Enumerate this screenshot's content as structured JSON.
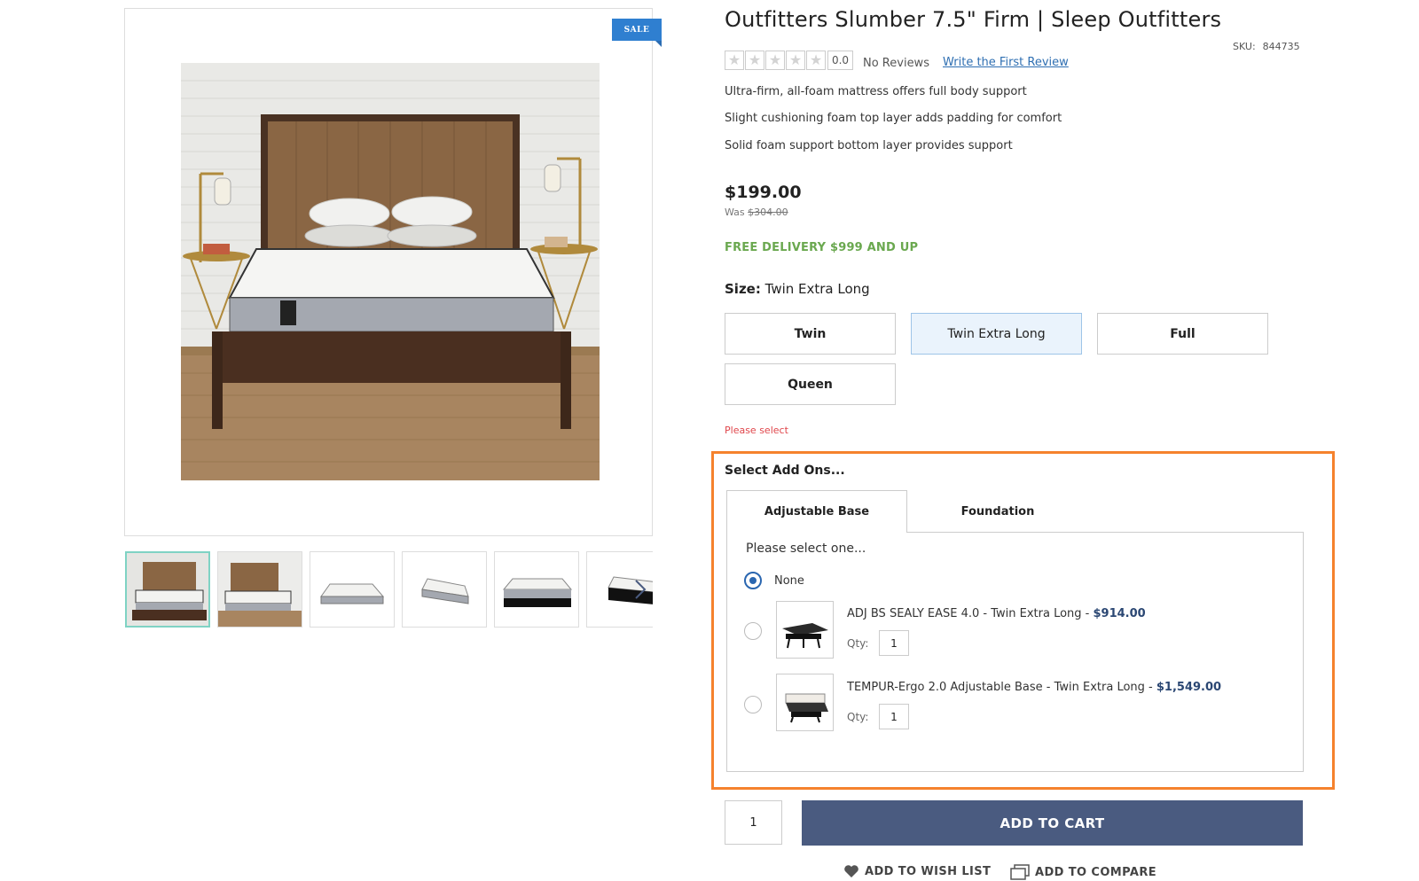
{
  "gallery": {
    "badge": "SALE",
    "thumbnails": [
      {
        "icon": "bedroom-photo"
      },
      {
        "icon": "bedroom-photo"
      },
      {
        "icon": "mattress-photo"
      },
      {
        "icon": "mattress-photo"
      },
      {
        "icon": "mattress-photo"
      },
      {
        "icon": "mattress-photo"
      }
    ],
    "next_icon": "chevron-right-icon"
  },
  "product": {
    "title": "Outfitters Slumber 7.5\" Firm | Sleep Outfitters",
    "sku_label": "SKU:",
    "sku_value": "844735",
    "rating_score": "0.0",
    "reviews_text": "No Reviews",
    "write_review": "Write the First Review",
    "features": [
      "Ultra-firm, all-foam mattress offers full body support",
      "Slight cushioning foam top layer adds padding for comfort",
      "Solid foam support bottom layer provides support"
    ],
    "price": "$199.00",
    "was_label": "Was",
    "was_price": "$304.00",
    "free_delivery": "FREE DELIVERY $999 AND UP"
  },
  "size": {
    "label": "Size:",
    "selected": "Twin Extra Long",
    "options": [
      "Twin",
      "Twin Extra Long",
      "Full",
      "Queen"
    ],
    "error": "Please select"
  },
  "addons": {
    "title": "Select Add Ons...",
    "tabs": [
      "Adjustable Base",
      "Foundation"
    ],
    "prompt": "Please select one...",
    "none_label": "None",
    "qty_label": "Qty:",
    "items": [
      {
        "name": "ADJ BS SEALY EASE 4.0 - Twin Extra Long - ",
        "price": "$914.00",
        "qty": "1"
      },
      {
        "name": "TEMPUR-Ergo 2.0 Adjustable Base - Twin Extra Long - ",
        "price": "$1,549.00",
        "qty": "1"
      }
    ],
    "accent_color": "#f5822d"
  },
  "cart": {
    "qty": "1",
    "add_to_cart": "ADD TO CART",
    "wish_list": "ADD TO WISH LIST",
    "compare": "ADD TO COMPARE",
    "button_color": "#4a5b80"
  }
}
